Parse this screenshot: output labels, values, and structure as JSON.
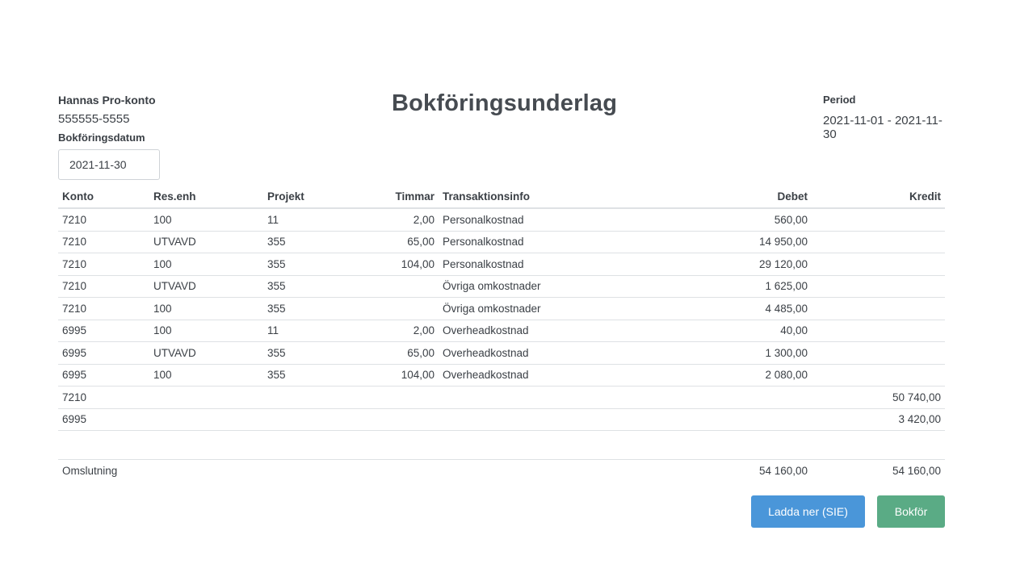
{
  "header": {
    "org_name": "Hannas Pro-konto",
    "org_number": "555555-5555",
    "date_label": "Bokföringsdatum",
    "date_value": "2021-11-30",
    "title": "Bokföringsunderlag",
    "period_label": "Period",
    "period_value": "2021-11-01 - 2021-11-30"
  },
  "table": {
    "columns": {
      "konto": "Konto",
      "resenh": "Res.enh",
      "projekt": "Projekt",
      "timmar": "Timmar",
      "info": "Transaktionsinfo",
      "debet": "Debet",
      "kredit": "Kredit"
    },
    "rows": [
      {
        "konto": "7210",
        "resenh": "100",
        "projekt": "11",
        "timmar": "2,00",
        "info": "Personalkostnad",
        "debet": "560,00",
        "kredit": ""
      },
      {
        "konto": "7210",
        "resenh": "UTVAVD",
        "projekt": "355",
        "timmar": "65,00",
        "info": "Personalkostnad",
        "debet": "14 950,00",
        "kredit": ""
      },
      {
        "konto": "7210",
        "resenh": "100",
        "projekt": "355",
        "timmar": "104,00",
        "info": "Personalkostnad",
        "debet": "29 120,00",
        "kredit": ""
      },
      {
        "konto": "7210",
        "resenh": "UTVAVD",
        "projekt": "355",
        "timmar": "",
        "info": "Övriga omkostnader",
        "debet": "1 625,00",
        "kredit": ""
      },
      {
        "konto": "7210",
        "resenh": "100",
        "projekt": "355",
        "timmar": "",
        "info": "Övriga omkostnader",
        "debet": "4 485,00",
        "kredit": ""
      },
      {
        "konto": "6995",
        "resenh": "100",
        "projekt": "11",
        "timmar": "2,00",
        "info": "Overheadkostnad",
        "debet": "40,00",
        "kredit": ""
      },
      {
        "konto": "6995",
        "resenh": "UTVAVD",
        "projekt": "355",
        "timmar": "65,00",
        "info": "Overheadkostnad",
        "debet": "1 300,00",
        "kredit": ""
      },
      {
        "konto": "6995",
        "resenh": "100",
        "projekt": "355",
        "timmar": "104,00",
        "info": "Overheadkostnad",
        "debet": "2 080,00",
        "kredit": ""
      },
      {
        "konto": "7210",
        "resenh": "",
        "projekt": "",
        "timmar": "",
        "info": "",
        "debet": "",
        "kredit": "50 740,00"
      },
      {
        "konto": "6995",
        "resenh": "",
        "projekt": "",
        "timmar": "",
        "info": "",
        "debet": "",
        "kredit": "3 420,00"
      }
    ],
    "total": {
      "label": "Omslutning",
      "debet": "54 160,00",
      "kredit": "54 160,00"
    }
  },
  "actions": {
    "download_label": "Ladda ner (SIE)",
    "book_label": "Bokför"
  },
  "colors": {
    "download_button": "#4a96d9",
    "book_button": "#5aab85"
  }
}
